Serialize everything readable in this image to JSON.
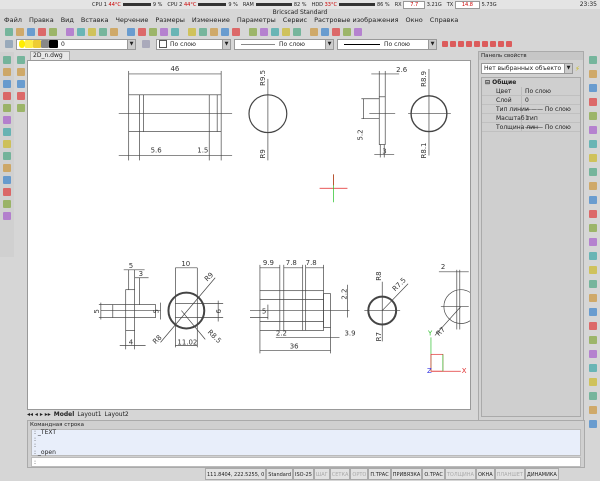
{
  "system_bar": {
    "cpu1_label": "CPU 1",
    "cpu1_temp": "44°C",
    "cpu1_pct": "9 %",
    "cpu2_label": "CPU 2",
    "cpu2_temp": "44°C",
    "cpu2_pct": "9 %",
    "ram_label": "RAM",
    "ram_pct": "82 %",
    "hdd_label": "HDD",
    "hdd_temp": "33°C",
    "hdd_pct": "86 %",
    "rx_label": "RX",
    "rx_value": "7.7",
    "rx_total": "3.21G",
    "tx_label": "TX",
    "tx_value": "14.8",
    "tx_total": "5.73G",
    "clock": "23:35"
  },
  "window": {
    "title": "Bricscad Standard"
  },
  "menu": [
    "Файл",
    "Правка",
    "Вид",
    "Вставка",
    "Черчение",
    "Размеры",
    "Изменение",
    "Параметры",
    "Сервис",
    "Растровые изображения",
    "Окно",
    "Справка"
  ],
  "toolbar1_icons": [
    "pencil-icon",
    "pan-icon",
    "zoom-realtime-icon",
    "zoom-in-icon",
    "zoom-out-icon",
    "zoom-window-icon",
    "zoom-extents-icon",
    "render-icon",
    "eye-icon",
    "chart-icon",
    "shield-icon",
    "grid-icon",
    "layout-icon",
    "page-icon",
    "new-file-icon",
    "open-folder-icon",
    "save-icon",
    "print-preview-icon",
    "print-icon",
    "cut-icon",
    "copy-icon",
    "paste-icon",
    "match-properties-icon",
    "delete-icon",
    "undo-icon",
    "redo-icon",
    "window-icon",
    "zoom-icon",
    "drawing-explorer-icon",
    "help-icon"
  ],
  "toolbar2": {
    "layer_value": "0",
    "color_value": "По слою",
    "linetype_value": "По слою",
    "lineweight_value": "По слою"
  },
  "toolbar2_snap_icons": [
    "snap-endpoint-icon",
    "snap-midpoint-icon",
    "snap-nearest-icon",
    "snap-center-icon",
    "snap-perpendicular-icon",
    "snap-parallel-icon",
    "snap-tangent-icon",
    "snap-quadrant-icon",
    "snap-insert-icon"
  ],
  "left_toolbar_icons": [
    "line-icon",
    "arc-icon",
    "circle-icon",
    "arc-3pt-icon",
    "spline-icon",
    "ellipse-icon",
    "rectangle-icon",
    "point-icon",
    "hatch-icon",
    "region-icon",
    "block-icon",
    "text-icon",
    "mtext-icon",
    "insert-block-icon"
  ],
  "left_toolbar2_icons": [
    "move-icon",
    "copy-object-icon",
    "array-icon",
    "offset-icon",
    "mirror-icon"
  ],
  "right_toolbar_icons": [
    "move-icon",
    "copy-icon",
    "stretch-icon",
    "scale-icon",
    "rotate-icon",
    "rotate3d-icon",
    "trim-icon",
    "extend-icon",
    "break-icon",
    "join-icon",
    "chamfer-icon",
    "fillet-icon",
    "explode-icon",
    "erase-icon",
    "mirror-icon",
    "offset-icon",
    "array-icon",
    "align-icon",
    "edit-pline-icon",
    "edit-spline-icon",
    "edit-hatch-icon",
    "edit-text-icon",
    "properties-icon",
    "lengthen-icon",
    "divide-icon",
    "measure-icon",
    "explode2-icon"
  ],
  "document": {
    "tab": "2D_n.dwg"
  },
  "layout_tabs": [
    "Model",
    "Layout1",
    "Layout2"
  ],
  "drawing_labels": {
    "d46": "46",
    "d56": "5.6",
    "d15": "1.5",
    "r95": "R9.5",
    "r9": "R9",
    "d26": "2.6",
    "r89": "R8.9",
    "r81": "R8.1",
    "d52": "5.2",
    "d3a": "3",
    "d5a": "5",
    "d3b": "3",
    "d4": "4",
    "d5b": "5",
    "d5c": "5",
    "d10": "10",
    "r9b": "R9",
    "r8": "R8",
    "r85": "R8.5",
    "d1102": "11.02",
    "d6": "6",
    "d99": "9.9",
    "d78a": "7.8",
    "d78b": "7.8",
    "d5d": "5",
    "d22a": "2.2",
    "d39": "3.9",
    "d36": "36",
    "d22b": "2.2",
    "r8b": "R8",
    "r75": "R7.5",
    "r7": "R7",
    "d2": "2",
    "r7b": "R7",
    "ucs_x": "X",
    "ucs_y": "Y",
    "ucs_z": "Z"
  },
  "properties_panel": {
    "title": "Панель свойств",
    "selection": "Нет выбранных объекто",
    "section": "Общие",
    "rows": [
      {
        "label": "Цвет",
        "value": "По слою"
      },
      {
        "label": "Слой",
        "value": "0"
      },
      {
        "label": "Тип линии",
        "value": "——— По слою"
      },
      {
        "label": "Масштаб тип",
        "value": "1"
      },
      {
        "label": "Толщина лин",
        "value": "——— По слою"
      }
    ]
  },
  "command_line": {
    "title": "Командная строка",
    "history": [
      ": _TEXT",
      ":",
      ":",
      ": _open"
    ],
    "prompt": ":"
  },
  "status_bar": {
    "coords": "111.8404, 222.5255, 0",
    "items": [
      {
        "label": "Standard",
        "on": true
      },
      {
        "label": "ISO-25",
        "on": true
      },
      {
        "label": "ШАГ",
        "on": false
      },
      {
        "label": "СЕТКА",
        "on": false
      },
      {
        "label": "ОРТО",
        "on": false
      },
      {
        "label": "П.ТРАС",
        "on": true
      },
      {
        "label": "ПРИВЯЗКА",
        "on": true
      },
      {
        "label": "О.ТРАС",
        "on": true
      },
      {
        "label": "ТОЛЩИНА",
        "on": false
      },
      {
        "label": "ОКНА",
        "on": true
      },
      {
        "label": "ПЛАНШЕТ",
        "on": false
      },
      {
        "label": "ДИНАМИКА",
        "on": true
      }
    ]
  },
  "colors": {
    "cursor_red": "#e02020",
    "cursor_green": "#20c020",
    "ucs_x": "#e03030",
    "ucs_y": "#30c030",
    "ucs_z": "#3030e0",
    "line": "#444444"
  }
}
